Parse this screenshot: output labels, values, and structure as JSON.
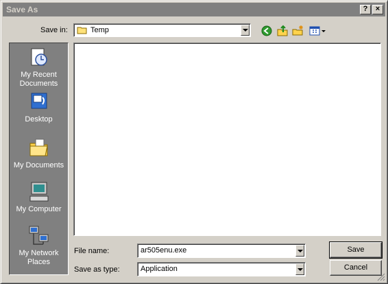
{
  "dialog": {
    "title": "Save As"
  },
  "titlebar": {
    "help_glyph": "?",
    "close_glyph": "×"
  },
  "toolbar": {
    "save_in_label": "Save in:",
    "save_in_value": "Temp",
    "icons": [
      "back-icon",
      "up-folder-icon",
      "new-folder-icon",
      "view-menu-icon"
    ]
  },
  "places": [
    {
      "label": "My Recent Documents",
      "icon": "recent-documents-icon"
    },
    {
      "label": "Desktop",
      "icon": "desktop-icon"
    },
    {
      "label": "My Documents",
      "icon": "my-documents-icon"
    },
    {
      "label": "My Computer",
      "icon": "my-computer-icon"
    },
    {
      "label": "My Network Places",
      "icon": "network-places-icon"
    }
  ],
  "form": {
    "filename_label": "File name:",
    "filename_value": "ar505enu.exe",
    "filetype_label": "Save as type:",
    "filetype_value": "Application"
  },
  "buttons": {
    "save": "Save",
    "cancel": "Cancel"
  },
  "colors": {
    "face": "#d4d0c8",
    "inactive_title": "#808080",
    "places_bar": "#808080"
  }
}
